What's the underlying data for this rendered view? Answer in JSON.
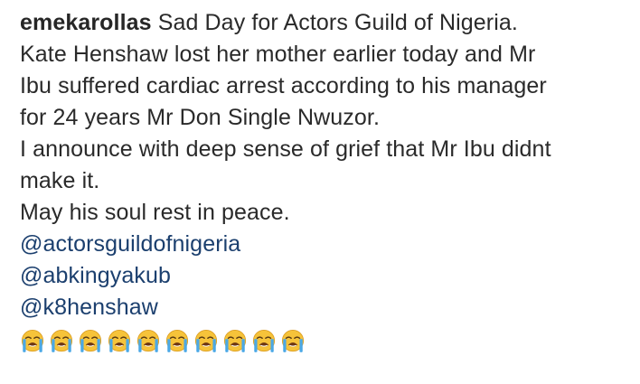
{
  "post": {
    "username": "emekarollas",
    "lines": [
      "Sad Day for Actors Guild of Nigeria.",
      "Kate Henshaw lost her mother earlier today and Mr",
      "Ibu suffered cardiac arrest according to his manager",
      "for 24 years Mr Don Single Nwuzor.",
      "I announce with deep sense of grief that Mr Ibu didnt",
      "make it.",
      "May his soul rest in peace."
    ],
    "mentions": [
      "@actorsguildofnigeria",
      "@abkingyakub",
      "@k8henshaw"
    ],
    "emojis": {
      "icon": "loudly-crying-face-icon",
      "count": 10
    }
  },
  "colors": {
    "text": "#2a2a2a",
    "mention": "#1b3f6e",
    "emoji_face": "#f6c33a",
    "emoji_tears": "#4aa8e6"
  }
}
